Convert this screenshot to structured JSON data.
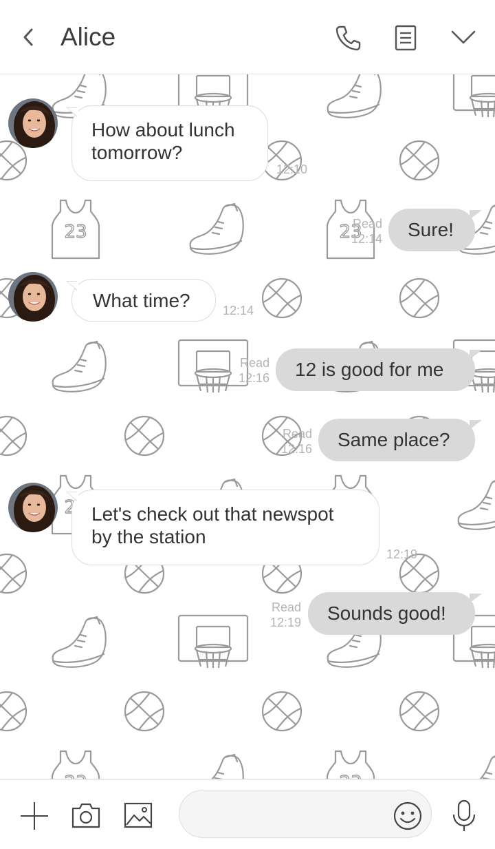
{
  "header": {
    "contact_name": "Alice",
    "back_icon": "chevron-left-icon",
    "call_icon": "phone-icon",
    "notes_icon": "notes-icon",
    "menu_icon": "chevron-down-icon"
  },
  "messages": [
    {
      "direction": "incoming",
      "text_lines": [
        "How about lunch",
        "tomorrow?"
      ],
      "time": "12:10"
    },
    {
      "direction": "outgoing",
      "text": "Sure!",
      "read": "Read",
      "time": "12:14"
    },
    {
      "direction": "incoming",
      "text": "What time?",
      "time": "12:14"
    },
    {
      "direction": "outgoing",
      "text": "12 is good for me",
      "read": "Read",
      "time": "12:16"
    },
    {
      "direction": "outgoing",
      "text": "Same place?",
      "read": "Read",
      "time": "12:16"
    },
    {
      "direction": "incoming",
      "text_lines": [
        "Let's check out that newspot",
        "by the station"
      ],
      "time": "12:19"
    },
    {
      "direction": "outgoing",
      "text": "Sounds good!",
      "read": "Read",
      "time": "12:19"
    }
  ],
  "input_bar": {
    "placeholder": "",
    "value": "",
    "icons": [
      "plus-icon",
      "camera-icon",
      "image-icon",
      "emoji-icon",
      "microphone-icon"
    ]
  },
  "colors": {
    "outgoing_bubble": "#d9d9d9",
    "incoming_bubble": "#ffffff",
    "meta_text": "#b4b4b4",
    "wallpaper_line": "#9a9a9a"
  }
}
